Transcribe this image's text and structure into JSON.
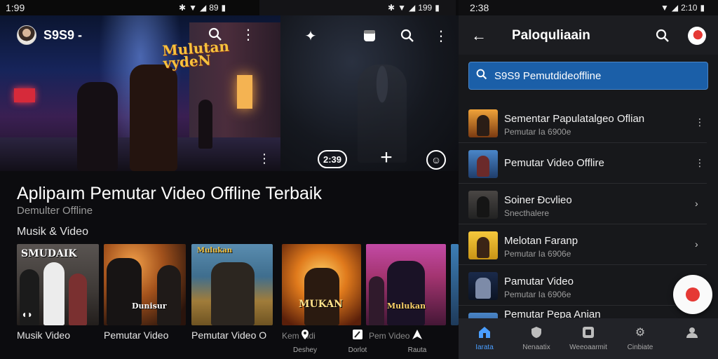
{
  "status": {
    "left_time": "1:99",
    "left_battery": "89",
    "mid_battery": "199",
    "right_time": "2:38",
    "right_battery": "2:10"
  },
  "left_app": {
    "account_name": "S9S9 -",
    "hero_art_title_1": "Mulutan",
    "hero_art_title_2": "vydeN",
    "counter": "2:39",
    "title": "Aplipaım Pemutar Video Offline Terbaik",
    "subtitle": "Demulter Offline",
    "section_title": "Musik & Video",
    "thumbnails": [
      {
        "caption": "SMUDAIK",
        "label": "Musik Video"
      },
      {
        "caption": "Dunisur",
        "label": "Pemutar Video"
      },
      {
        "caption": "Mulukan",
        "label": "Pemutar Video O"
      },
      {
        "caption": "MUKAN",
        "label": "Kem Vidi"
      },
      {
        "caption": "Mulukan",
        "label": "Pem Video"
      }
    ],
    "mid_nav": [
      {
        "icon": "location-icon",
        "label": "Deshey"
      },
      {
        "icon": "edit-icon",
        "label": "Dorlot"
      },
      {
        "icon": "triangle-icon",
        "label": "Rauta"
      }
    ]
  },
  "right_app": {
    "title": "Paloquliaain",
    "search": {
      "value": "S9S9 Pemutdideoffline"
    },
    "list": [
      {
        "title": "Sementar Papulatalgeo Oflian",
        "subtitle": "Pemutar Ia 6900e",
        "action": "⋮"
      },
      {
        "title": "Pemutar Video Offlire",
        "subtitle": "",
        "action": "⋮"
      },
      {
        "title": "Soiner Ðcvlieo",
        "subtitle": "Snecthalere",
        "action": "›"
      },
      {
        "title": "Melotan Faranp",
        "subtitle": "Pemutar Ia 6906e",
        "action": "›"
      },
      {
        "title": "Pamutar Video",
        "subtitle": "Pemutar Ia 6906e",
        "action": ""
      },
      {
        "title": "Pemutar Pepa Anian",
        "subtitle": "",
        "action": ""
      }
    ],
    "bottom_nav": [
      {
        "icon": "home-icon",
        "label": "Iarata",
        "active": true
      },
      {
        "icon": "shield-icon",
        "label": "Nenaatix",
        "active": false
      },
      {
        "icon": "library-icon",
        "label": "Weeoaarmit",
        "active": false
      },
      {
        "icon": "settings-icon",
        "label": "Cinbiate",
        "active": false
      },
      {
        "icon": "profile-icon",
        "label": "",
        "active": false
      }
    ]
  },
  "colors": {
    "accent": "#4a9eff",
    "search_bg": "#1b5fa8",
    "record": "#e53935"
  }
}
